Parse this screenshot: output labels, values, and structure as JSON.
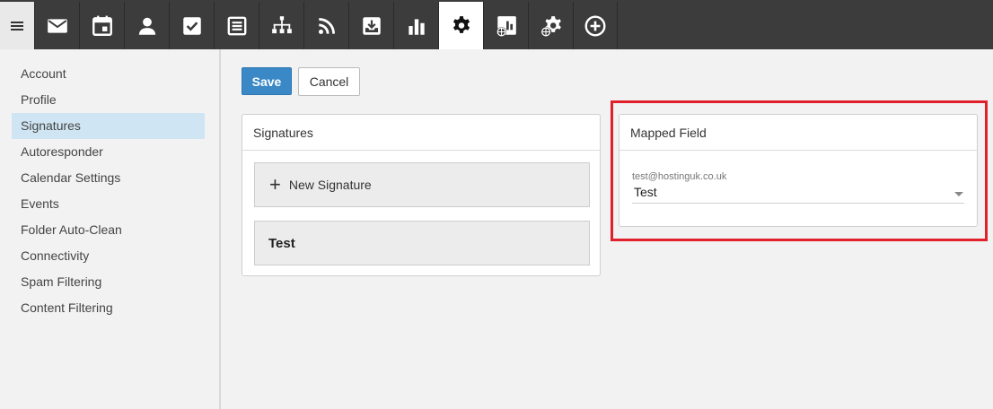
{
  "toolbar": {
    "menu_icon": "hamburger-icon",
    "tools": [
      {
        "name": "mail-icon",
        "active": false
      },
      {
        "name": "calendar-icon",
        "active": false
      },
      {
        "name": "contacts-icon",
        "active": false
      },
      {
        "name": "tasks-icon",
        "active": false
      },
      {
        "name": "notes-icon",
        "active": false
      },
      {
        "name": "sitemap-icon",
        "active": false
      },
      {
        "name": "rss-icon",
        "active": false
      },
      {
        "name": "archive-icon",
        "active": false
      },
      {
        "name": "reports-icon",
        "active": false
      },
      {
        "name": "settings-icon",
        "active": true
      },
      {
        "name": "domain-reports-icon",
        "active": false
      },
      {
        "name": "domain-settings-icon",
        "active": false
      },
      {
        "name": "add-icon",
        "active": false
      }
    ]
  },
  "sidebar": {
    "items": [
      {
        "label": "Account",
        "active": false
      },
      {
        "label": "Profile",
        "active": false
      },
      {
        "label": "Signatures",
        "active": true
      },
      {
        "label": "Autoresponder",
        "active": false
      },
      {
        "label": "Calendar Settings",
        "active": false
      },
      {
        "label": "Events",
        "active": false
      },
      {
        "label": "Folder Auto-Clean",
        "active": false
      },
      {
        "label": "Connectivity",
        "active": false
      },
      {
        "label": "Spam Filtering",
        "active": false
      },
      {
        "label": "Content Filtering",
        "active": false
      }
    ]
  },
  "actions": {
    "save_label": "Save",
    "cancel_label": "Cancel"
  },
  "signatures_panel": {
    "title": "Signatures",
    "new_label": "New Signature",
    "items": [
      "Test"
    ]
  },
  "mapped_panel": {
    "title": "Mapped Field",
    "field_label": "test@hostinguk.co.uk",
    "field_value": "Test"
  },
  "colors": {
    "topbar": "#3c3c3c",
    "accent": "#3a88c6",
    "active_sidebar": "#cfe5f3",
    "highlight": "#e0202a"
  }
}
